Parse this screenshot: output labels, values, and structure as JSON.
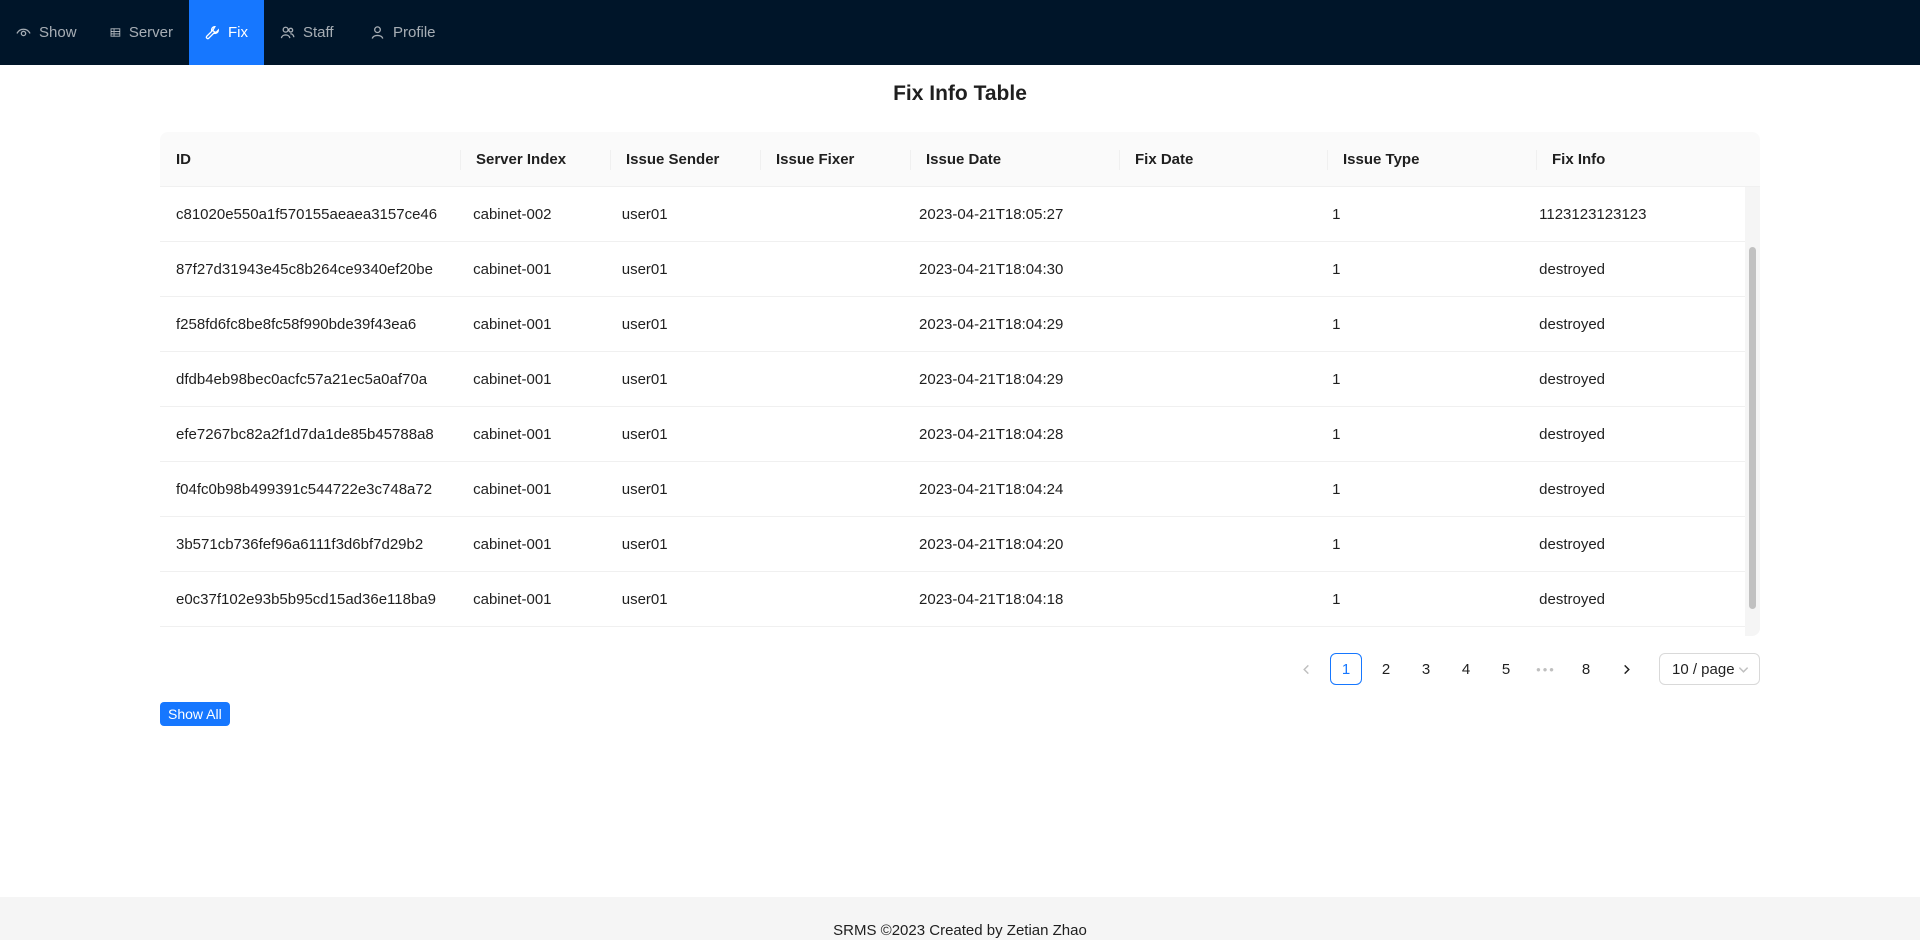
{
  "nav": {
    "items": [
      {
        "label": "Show",
        "icon": "eye-icon",
        "active": false
      },
      {
        "label": "Server",
        "icon": "table-icon",
        "active": false
      },
      {
        "label": "Fix",
        "icon": "wrench-icon",
        "active": true
      },
      {
        "label": "Staff",
        "icon": "team-icon",
        "active": false
      },
      {
        "label": "Profile",
        "icon": "user-icon",
        "active": false
      }
    ]
  },
  "page": {
    "title": "Fix Info Table"
  },
  "table": {
    "columns": [
      "ID",
      "Server Index",
      "Issue Sender",
      "Issue Fixer",
      "Issue Date",
      "Fix Date",
      "Issue Type",
      "Fix Info"
    ],
    "rows": [
      [
        "c81020e550a1f570155aeaea3157ce46",
        "cabinet-002",
        "user01",
        "",
        "2023-04-21T18:05:27",
        "",
        "1",
        "1123123123123"
      ],
      [
        "87f27d31943e45c8b264ce9340ef20be",
        "cabinet-001",
        "user01",
        "",
        "2023-04-21T18:04:30",
        "",
        "1",
        "destroyed"
      ],
      [
        "f258fd6fc8be8fc58f990bde39f43ea6",
        "cabinet-001",
        "user01",
        "",
        "2023-04-21T18:04:29",
        "",
        "1",
        "destroyed"
      ],
      [
        "dfdb4eb98bec0acfc57a21ec5a0af70a",
        "cabinet-001",
        "user01",
        "",
        "2023-04-21T18:04:29",
        "",
        "1",
        "destroyed"
      ],
      [
        "efe7267bc82a2f1d7da1de85b45788a8",
        "cabinet-001",
        "user01",
        "",
        "2023-04-21T18:04:28",
        "",
        "1",
        "destroyed"
      ],
      [
        "f04fc0b98b499391c544722e3c748a72",
        "cabinet-001",
        "user01",
        "",
        "2023-04-21T18:04:24",
        "",
        "1",
        "destroyed"
      ],
      [
        "3b571cb736fef96a6111f3d6bf7d29b2",
        "cabinet-001",
        "user01",
        "",
        "2023-04-21T18:04:20",
        "",
        "1",
        "destroyed"
      ],
      [
        "e0c37f102e93b5b95cd15ad36e118ba9",
        "cabinet-001",
        "user01",
        "",
        "2023-04-21T18:04:18",
        "",
        "1",
        "destroyed"
      ]
    ]
  },
  "pagination": {
    "pages": [
      "1",
      "2",
      "3",
      "4",
      "5"
    ],
    "ellipsis": "•••",
    "last": "8",
    "current": "1",
    "page_size": "10 / page"
  },
  "actions": {
    "show_all_label": "Show All"
  },
  "footer": {
    "text": "SRMS ©2023 Created by Zetian Zhao"
  },
  "colors": {
    "nav_bg": "#001529",
    "accent": "#1677ff"
  }
}
